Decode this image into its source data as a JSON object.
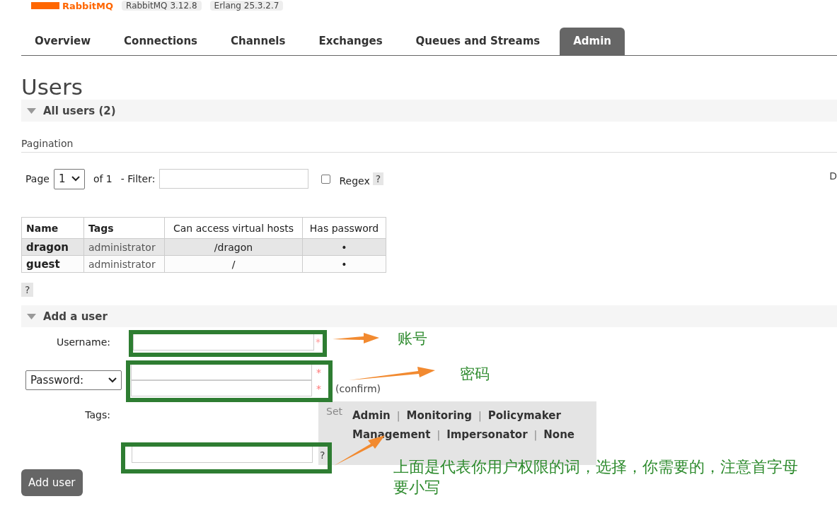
{
  "header": {
    "logo": "RabbitMQ",
    "badges": [
      "RabbitMQ 3.12.8",
      "Erlang 25.3.2.7"
    ]
  },
  "tabs": [
    {
      "label": "Overview",
      "selected": false
    },
    {
      "label": "Connections",
      "selected": false
    },
    {
      "label": "Channels",
      "selected": false
    },
    {
      "label": "Exchanges",
      "selected": false
    },
    {
      "label": "Queues and Streams",
      "selected": false
    },
    {
      "label": "Admin",
      "selected": true
    }
  ],
  "page_title": "Users",
  "all_users": {
    "title": "All users (2)",
    "expanded": true
  },
  "pagination": {
    "heading": "Pagination",
    "page_label": "Page",
    "page_value": "1",
    "of_label": "of 1",
    "filter_label": "- Filter:",
    "regex_label": "Regex",
    "regex_checked": false,
    "help": "?",
    "cut_text": "D"
  },
  "users_table": {
    "columns": [
      "Name",
      "Tags",
      "Can access virtual hosts",
      "Has password"
    ],
    "rows": [
      {
        "name": "dragon",
        "tags": "administrator",
        "vhosts": "/dragon",
        "has_password": "•",
        "selected": true
      },
      {
        "name": "guest",
        "tags": "administrator",
        "vhosts": "/",
        "has_password": "•",
        "selected": false
      }
    ],
    "help": "?"
  },
  "add_user": {
    "title": "Add a user",
    "expanded": true,
    "username_label": "Username:",
    "password_select": "Password:",
    "required_marks": [
      "*",
      "*",
      "*"
    ],
    "confirm_label": "(confirm)",
    "tags_label": "Tags:",
    "set_label": "Set",
    "tag_options": [
      [
        "Admin",
        "Monitoring",
        "Policymaker"
      ],
      [
        "Management",
        "Impersonator",
        "None"
      ]
    ],
    "separator": "|",
    "help": "?",
    "button": "Add user"
  },
  "annotations": [
    {
      "text": "账号"
    },
    {
      "text": "密码"
    },
    {
      "text": "上面是代表你用户权限的词，选择，你需要的，注意首字母要小写"
    }
  ]
}
